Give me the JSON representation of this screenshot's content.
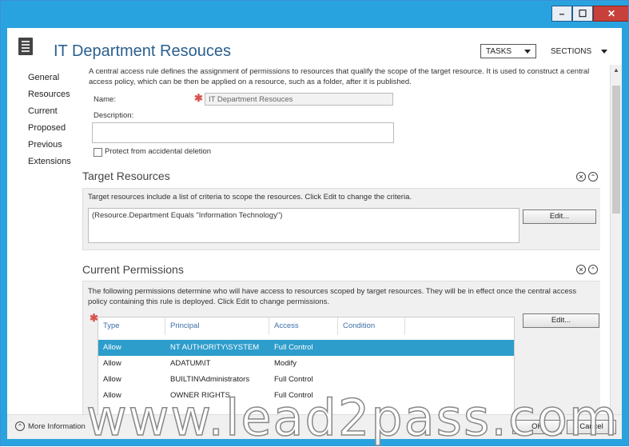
{
  "window": {
    "controls": {
      "minimize": "–",
      "maximize": "☐",
      "close": "✕"
    }
  },
  "header": {
    "title": "IT Department Resouces",
    "icon": "document-icon",
    "tasks_label": "TASKS",
    "sections_label": "SECTIONS"
  },
  "nav": {
    "items": [
      {
        "label": "General"
      },
      {
        "label": "Resources"
      },
      {
        "label": "Current"
      },
      {
        "label": "Proposed"
      },
      {
        "label": "Previous"
      },
      {
        "label": "Extensions"
      }
    ]
  },
  "general": {
    "description_text": "A central access rule defines the assignment of permissions to resources that qualify the scope of the target resource. It is used to construct a central access policy, which can be then be applied on a resource, such as a folder, after it is published.",
    "name_label": "Name:",
    "name_value": "IT Department Resouces",
    "description_label": "Description:",
    "description_value": "",
    "protect_label": "Protect from accidental deletion"
  },
  "target_resources": {
    "heading": "Target Resources",
    "help_text": "Target resources include a list of criteria to scope the resources. Click Edit to change the criteria.",
    "criteria": "(Resource.Department Equals \"Information Technology\")",
    "edit_label": "Edit..."
  },
  "current_permissions": {
    "heading": "Current Permissions",
    "help_text": "The following permissions determine who will have access to resources scoped by target resources. They will be in effect once the central access policy containing this rule is deployed. Click Edit to change permissions.",
    "edit_label": "Edit...",
    "columns": [
      "Type",
      "Principal",
      "Access",
      "Condition"
    ],
    "rows": [
      {
        "type": "Allow",
        "principal": "NT AUTHORITY\\SYSTEM",
        "access": "Full Control",
        "condition": "",
        "selected": true
      },
      {
        "type": "Allow",
        "principal": "ADATUM\\IT",
        "access": "Modify",
        "condition": ""
      },
      {
        "type": "Allow",
        "principal": "BUILTIN\\Administrators",
        "access": "Full Control",
        "condition": ""
      },
      {
        "type": "Allow",
        "principal": "OWNER RIGHTS",
        "access": "Full Control",
        "condition": ""
      }
    ]
  },
  "footer": {
    "more_info": "More Information",
    "ok_label": "OK",
    "cancel_label": "Cancel"
  },
  "watermark": "www.lead2pass.com",
  "colors": {
    "title_bar": "#29a3df",
    "accent": "#2b5f8f",
    "selected_row": "#2d9dcc",
    "required": "#d9534f"
  }
}
